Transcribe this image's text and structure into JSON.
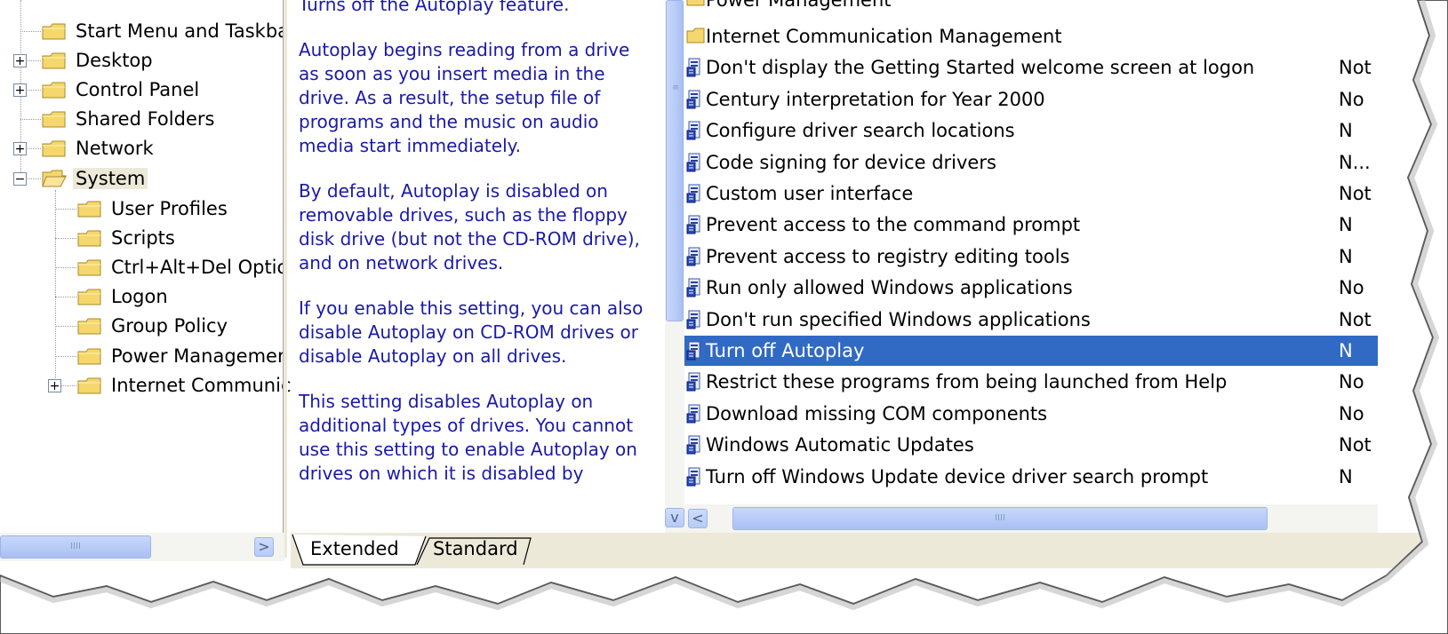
{
  "tree": {
    "items": [
      {
        "label": "Start Menu and Taskba",
        "expander": ""
      },
      {
        "label": "Desktop",
        "expander": "+"
      },
      {
        "label": "Control Panel",
        "expander": "+"
      },
      {
        "label": "Shared Folders",
        "expander": ""
      },
      {
        "label": "Network",
        "expander": "+"
      },
      {
        "label": "System",
        "expander": "−",
        "selected": true
      },
      {
        "label": "User Profiles",
        "expander": ""
      },
      {
        "label": "Scripts",
        "expander": ""
      },
      {
        "label": "Ctrl+Alt+Del Optio",
        "expander": ""
      },
      {
        "label": "Logon",
        "expander": ""
      },
      {
        "label": "Group Policy",
        "expander": ""
      },
      {
        "label": "Power Managemen",
        "expander": ""
      },
      {
        "label": "Internet Communic",
        "expander": "+"
      }
    ]
  },
  "description": {
    "paragraphs": [
      "Turns off the Autoplay feature.",
      "Autoplay begins reading from a drive as soon as you insert media in the drive. As a result, the setup file of programs and the music on audio media start immediately.",
      "By default, Autoplay is disabled on removable drives, such as the floppy disk drive (but not the CD-ROM drive), and on network drives.",
      "If you enable this setting, you can also disable Autoplay on CD-ROM drives or disable Autoplay on all drives.",
      "This setting disables Autoplay on additional types of drives. You cannot use this setting to enable Autoplay on drives on which it is disabled by"
    ]
  },
  "list": {
    "partial_top": "Power Management",
    "rows": [
      {
        "label": "Internet Communication Management",
        "state": "",
        "type": "folder"
      },
      {
        "label": "Don't display the Getting Started welcome screen at logon",
        "state": "Not",
        "type": "setting"
      },
      {
        "label": "Century interpretation for Year 2000",
        "state": "No",
        "type": "setting"
      },
      {
        "label": "Configure driver search locations",
        "state": "N",
        "type": "setting"
      },
      {
        "label": "Code signing for device drivers",
        "state": "N...",
        "type": "setting"
      },
      {
        "label": "Custom user interface",
        "state": "Not",
        "type": "setting"
      },
      {
        "label": "Prevent access to the command prompt",
        "state": "N",
        "type": "setting"
      },
      {
        "label": "Prevent access to registry editing tools",
        "state": "N",
        "type": "setting"
      },
      {
        "label": "Run only allowed Windows applications",
        "state": "No",
        "type": "setting"
      },
      {
        "label": "Don't run specified Windows applications",
        "state": "Not",
        "type": "setting"
      },
      {
        "label": "Turn off Autoplay",
        "state": "N",
        "type": "setting",
        "selected": true
      },
      {
        "label": "Restrict these programs from being launched from Help",
        "state": "No",
        "type": "setting"
      },
      {
        "label": "Download missing COM components",
        "state": "No",
        "type": "setting"
      },
      {
        "label": "Windows Automatic Updates",
        "state": "Not",
        "type": "setting"
      },
      {
        "label": "Turn off Windows Update device driver search prompt",
        "state": "N",
        "type": "setting"
      }
    ]
  },
  "tabs": {
    "extended": "Extended",
    "standard": "Standard",
    "active": "Extended"
  },
  "scroll": {
    "left_arrow": "<",
    "right_arrow": ">",
    "down_arrow": "v",
    "grip": "IIII"
  },
  "colors": {
    "selection": "#316ac5",
    "description_text": "#1a1aa6",
    "tab_strip": "#ece9d8"
  }
}
